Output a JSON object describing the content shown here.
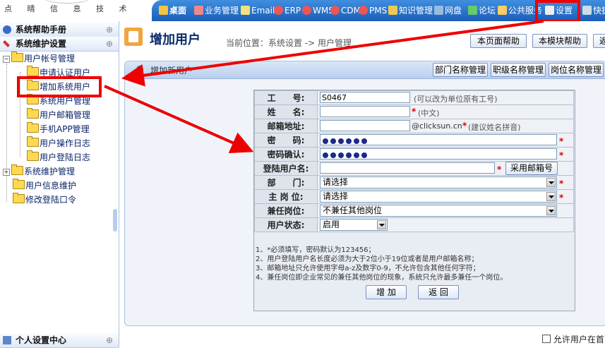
{
  "logo": {
    "subtitle": "点 晴 信 息 技 术"
  },
  "topnav": [
    {
      "label": "桌面",
      "color": "#f4c542",
      "bold": true
    },
    {
      "label": "业务管理",
      "color": "#e88"
    },
    {
      "label": "Email",
      "color": "#f2e27a"
    },
    {
      "label": "ERP",
      "color": "#e55"
    },
    {
      "label": "WMS",
      "color": "#e55"
    },
    {
      "label": "CDM",
      "color": "#e55"
    },
    {
      "label": "PMS",
      "color": "#e55"
    },
    {
      "label": "知识管理",
      "color": "#f2c94c"
    },
    {
      "label": "网盘",
      "color": "#9bd"
    },
    {
      "label": "论坛",
      "color": "#6c6"
    },
    {
      "label": "公共服务",
      "color": "#fc6"
    },
    {
      "label": "设置",
      "color": "#eee"
    },
    {
      "label": "快捷",
      "color": "#cde"
    }
  ],
  "sidebar": {
    "help_title": "系统帮助手册",
    "maint_title": "系统维护设置",
    "personal_title": "个人设置中心",
    "tree": {
      "user_account": "用户帐号管理",
      "apply_cert": "申请认证用户",
      "add_user": "增加系统用户",
      "sys_user_mgmt": "系统用户管理",
      "mail_mgmt": "用户邮箱管理",
      "app_mgmt": "手机APP管理",
      "op_log": "用户操作日志",
      "login_log": "用户登陆日志",
      "sys_maint": "系统维护管理",
      "user_info": "用户信息维护",
      "change_pwd": "修改登陆口令"
    }
  },
  "main": {
    "title": "增加用户",
    "breadcrumb": "当前位置：系统设置 -> 用户管理",
    "help_page": "本页面帮助",
    "help_module": "本模块帮助",
    "back": "返",
    "panel_title": "增加新用户",
    "panel_buttons": [
      "部门名称管理",
      "职级名称管理",
      "岗位名称管理"
    ],
    "allow_checkbox": "允许用户在首页"
  },
  "form": {
    "labels": {
      "empno": "工　　号:",
      "name": "姓　　名:",
      "email": "邮箱地址:",
      "password": "密　　码:",
      "confirm": "密码确认:",
      "login": "登陆用户名:",
      "dept": "部　　门:",
      "position": "主 岗 位:",
      "parttime": "兼任岗位:",
      "status": "用户状态:"
    },
    "empno_value": "S0467",
    "empno_hint": "(可以改为单位原有工号)",
    "name_hint": "(中文)",
    "email_domain": "@clicksun.cn",
    "email_hint": "(建议姓名拼音)",
    "use_email_button": "采用邮箱号",
    "dept_value": "请选择",
    "position_value": "请选择",
    "parttime_value": "不兼任其他岗位",
    "status_value": "启用",
    "required_mark": "*",
    "password_dots": 6,
    "notes": [
      "1、*必须填写，密码默认为123456；",
      "2、用户登陆用户名长度必须为大于2位小于19位或者是用户邮箱名称；",
      "3、邮箱地址只允许使用字母a-z及数字0-9，不允许包含其他任何字符；",
      "4、兼任岗位即企业常见的兼任其他岗位的现象，系统只允许最多兼任一个岗位。"
    ],
    "add_button": "增 加",
    "back_button": "返 回"
  },
  "colors": {
    "nav": "#1b5db8",
    "highlight": "#e00000"
  }
}
